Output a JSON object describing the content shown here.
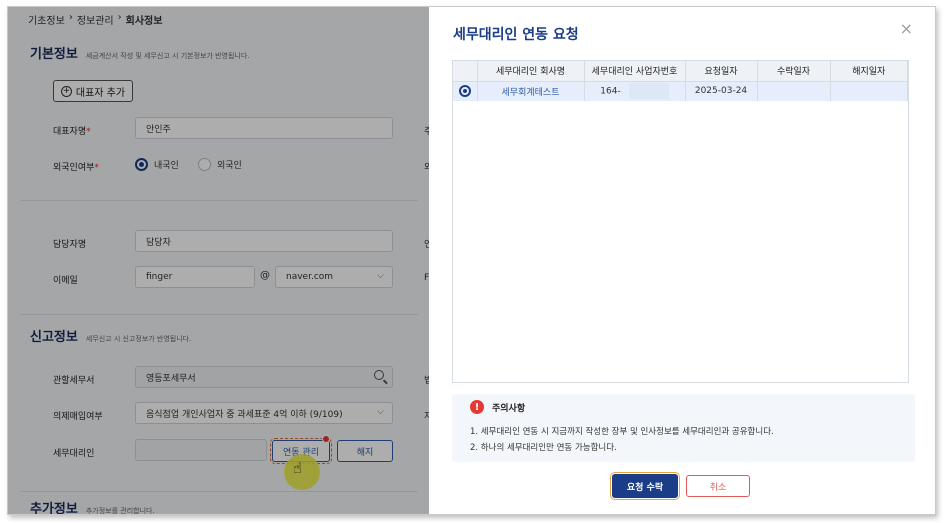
{
  "breadcrumb": [
    "기초정보",
    "정보관리",
    "회사정보"
  ],
  "sections": {
    "basic": {
      "title": "기본정보",
      "desc": "세금계산서 작성 및 세무신고 시 기본정보가 반영됩니다."
    },
    "report": {
      "title": "신고정보",
      "desc": "세무신고 시 신고정보가 반영됩니다."
    },
    "extra": {
      "title": "추가정보",
      "desc": "추가정보를 관리합니다."
    }
  },
  "form": {
    "add_rep_button": "대표자 추가",
    "rep_name_label": "대표자명",
    "rep_name_value": "안인주",
    "foreigner_label": "외국인여부",
    "radio_domestic": "내국인",
    "radio_foreign": "외국인",
    "manager_label": "담당자명",
    "manager_value": "담당자",
    "email_label": "이메일",
    "email_local": "finger",
    "email_at": "@",
    "email_domain": "naver.com",
    "tax_office_label": "관할세무서",
    "tax_office_value": "영등포세무서",
    "deemed_label": "의제매입여부",
    "deemed_value": "음식점업 개인사업자 중 과세표준 4억 이하 (9/109)",
    "agent_label": "세무대리인",
    "link_button": "연동 관리",
    "unlink_button": "해지",
    "edge_letters": [
      "주",
      "외",
      "연",
      "F",
      "법",
      "지"
    ]
  },
  "modal": {
    "title": "세무대리인 연동 요청",
    "close": "×",
    "columns": [
      "",
      "세무대리인 회사명",
      "세무대리인 사업자번호",
      "요청일자",
      "수락일자",
      "해지일자"
    ],
    "rows": [
      {
        "company": "세무회계테스트",
        "bizno": "164-",
        "request_date": "2025-03-24",
        "accept_date": "",
        "cancel_date": ""
      }
    ],
    "notice_title": "주의사항",
    "notice_lines": [
      "1. 세무대리인 연동 시 지금까지 작성한 장부 및 인사정보를 세무대리인과 공유합니다.",
      "2. 하나의 세무대리인만 연동 가능합니다."
    ],
    "accept_button": "요청 수락",
    "cancel_button": "취소"
  },
  "colors": {
    "primary": "#1b3c87",
    "danger": "#e53935",
    "link": "#2f5aa8"
  },
  "icons": {
    "add": "plus-circle-icon",
    "search": "search-icon",
    "dropdown": "chevron-down-icon",
    "warning": "warning-icon",
    "close": "close-icon",
    "cursor": "hand-pointer-icon"
  }
}
